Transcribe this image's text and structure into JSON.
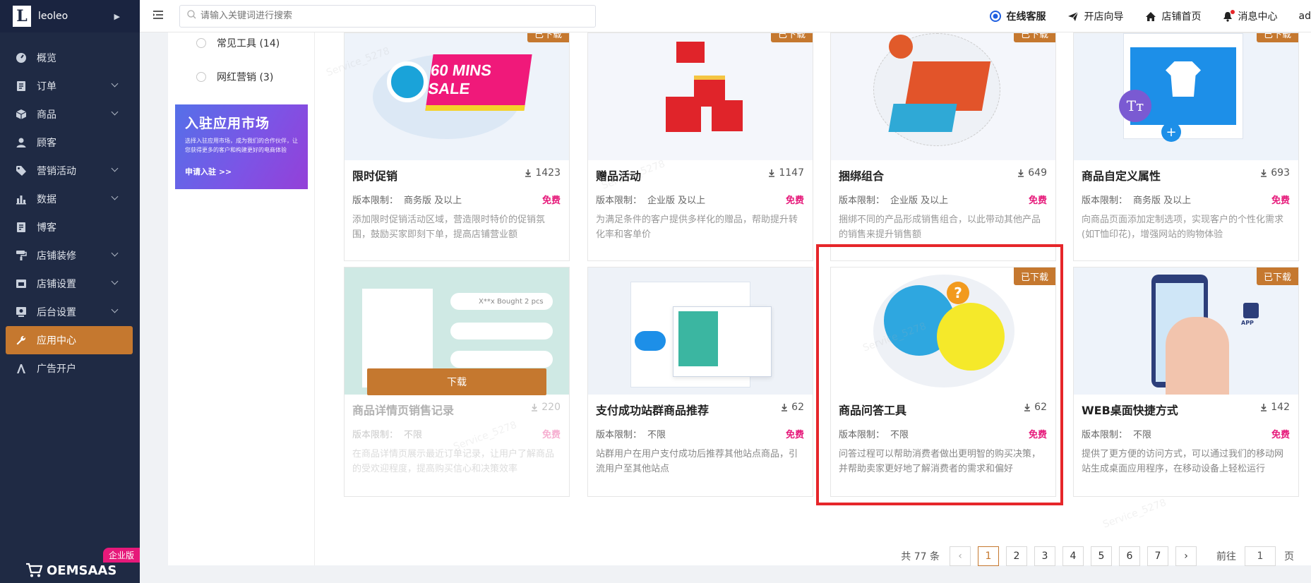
{
  "brand": {
    "name": "leoleo",
    "logo_letter": "L"
  },
  "sidebar": {
    "items": [
      {
        "label": "概览",
        "icon": "dashboard-icon",
        "expandable": false
      },
      {
        "label": "订单",
        "icon": "order-icon",
        "expandable": true
      },
      {
        "label": "商品",
        "icon": "product-icon",
        "expandable": true
      },
      {
        "label": "顾客",
        "icon": "user-icon",
        "expandable": false
      },
      {
        "label": "营销活动",
        "icon": "tag-icon",
        "expandable": true
      },
      {
        "label": "数据",
        "icon": "chart-icon",
        "expandable": true
      },
      {
        "label": "博客",
        "icon": "blog-icon",
        "expandable": false
      },
      {
        "label": "店铺装修",
        "icon": "paint-roller-icon",
        "expandable": true
      },
      {
        "label": "店铺设置",
        "icon": "store-settings-icon",
        "expandable": true
      },
      {
        "label": "后台设置",
        "icon": "admin-settings-icon",
        "expandable": true
      },
      {
        "label": "应用中心",
        "icon": "wrench-icon",
        "expandable": false,
        "active": true
      },
      {
        "label": "广告开户",
        "icon": "ad-icon",
        "expandable": false
      }
    ],
    "footer": {
      "brand": "OEMSAAS",
      "edition": "企业版"
    }
  },
  "topbar": {
    "search_placeholder": "请输入关键词进行搜索",
    "links": [
      {
        "label": "在线客服",
        "icon": "support-icon"
      },
      {
        "label": "开店向导",
        "icon": "paper-plane-icon"
      },
      {
        "label": "店铺首页",
        "icon": "home-icon"
      },
      {
        "label": "消息中心",
        "icon": "bell-icon"
      }
    ],
    "user": "ad"
  },
  "filters": {
    "options": [
      {
        "label": "常见工具 (14)"
      },
      {
        "label": "网红营销 (3)"
      }
    ],
    "banner": {
      "title": "入驻应用市场",
      "subtitle": "选择入驻应用市场，成为我们的合作伙伴，让您获得更多的客户和构建更好的电商体验",
      "link": "申请入驻 >>"
    }
  },
  "apps": [
    {
      "title": "限时促销",
      "downloads": "1423",
      "version_label": "版本限制：",
      "version": "商务版 及以上",
      "price": "免费",
      "desc": "添加限时促销活动区域，营造限时特价的促销氛围，鼓励买家即刻下单，提高店铺营业额",
      "badge": "已下载",
      "art": "60 MINS SALE"
    },
    {
      "title": "赠品活动",
      "downloads": "1147",
      "version_label": "版本限制：",
      "version": "企业版 及以上",
      "price": "免费",
      "desc": "为满足条件的客户提供多样化的赠品，帮助提升转化率和客单价",
      "badge": "已下载"
    },
    {
      "title": "捆绑组合",
      "downloads": "649",
      "version_label": "版本限制：",
      "version": "企业版 及以上",
      "price": "免费",
      "desc": "捆绑不同的产品形成销售组合，以此带动其他产品的销售来提升销售额",
      "badge": "已下载"
    },
    {
      "title": "商品自定义属性",
      "downloads": "693",
      "version_label": "版本限制：",
      "version": "商务版 及以上",
      "price": "免费",
      "desc": "向商品页面添加定制选项，实现客户的个性化需求(如T恤印花)，增强网站的购物体验",
      "badge": "已下载"
    },
    {
      "title": "商品详情页销售记录",
      "downloads": "220",
      "version_label": "版本限制：",
      "version": "不限",
      "price": "免费",
      "desc": "在商品详情页展示最近订单记录，让用户了解商品的受欢迎程度，提高购买信心和决策效率",
      "download_button": "下载",
      "art": "X**x Bought 2 pcs"
    },
    {
      "title": "支付成功站群商品推荐",
      "downloads": "62",
      "version_label": "版本限制：",
      "version": "不限",
      "price": "免费",
      "desc": "站群用户在用户支付成功后推荐其他站点商品，引流用户至其他站点"
    },
    {
      "title": "商品问答工具",
      "downloads": "62",
      "version_label": "版本限制：",
      "version": "不限",
      "price": "免费",
      "desc": "问答过程可以帮助消费者做出更明智的购买决策，并帮助卖家更好地了解消费者的需求和偏好",
      "badge": "已下载"
    },
    {
      "title": "WEB桌面快捷方式",
      "downloads": "142",
      "version_label": "版本限制：",
      "version": "不限",
      "price": "免费",
      "desc": "提供了更方便的访问方式，可以通过我们的移动网站生成桌面应用程序，在移动设备上轻松运行",
      "badge": "已下载",
      "art": "APP"
    }
  ],
  "pagination": {
    "total": "共 77 条",
    "pages": [
      "1",
      "2",
      "3",
      "4",
      "5",
      "6",
      "7"
    ],
    "current": "1",
    "goto_label": "前往",
    "goto_value": "1",
    "page_unit": "页"
  },
  "watermark": "Service_5278",
  "colors": {
    "accent": "#c5782f",
    "sidebar": "#1f2a44",
    "price": "#e6197a",
    "highlight": "#e6262a"
  }
}
